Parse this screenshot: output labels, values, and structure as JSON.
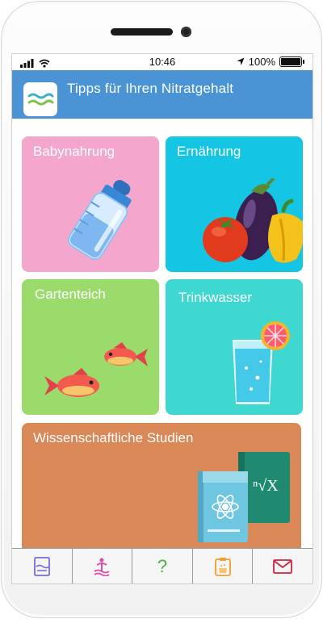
{
  "status": {
    "time": "10:46",
    "battery": "100%"
  },
  "header": {
    "title": "Tipps für Ihren Nitratgehalt",
    "icon": "waves-icon"
  },
  "tiles": [
    {
      "label": "Babynahrung",
      "icon": "baby-bottle-icon",
      "color": "#f4a6cc"
    },
    {
      "label": "Ernährung",
      "icon": "vegetables-icon",
      "color": "#14c6e3"
    },
    {
      "label": "Gartenteich",
      "icon": "fish-icon",
      "color": "#9bdb6b"
    },
    {
      "label": "Trinkwasser",
      "icon": "water-glass-icon",
      "color": "#3fd8d0"
    },
    {
      "label": "Wissenschaftliche Studien",
      "icon": "books-icon",
      "color": "#da8858"
    }
  ],
  "tabbar": {
    "tabs": [
      {
        "icon": "document-icon",
        "color": "#7b6bd6"
      },
      {
        "icon": "fountain-icon",
        "color": "#d94bb0"
      },
      {
        "icon": "help-icon",
        "label": "?",
        "color": "#44b03e"
      },
      {
        "icon": "clipboard-icon",
        "color": "#f0a030"
      },
      {
        "icon": "mail-icon",
        "color": "#d0243c"
      }
    ]
  }
}
